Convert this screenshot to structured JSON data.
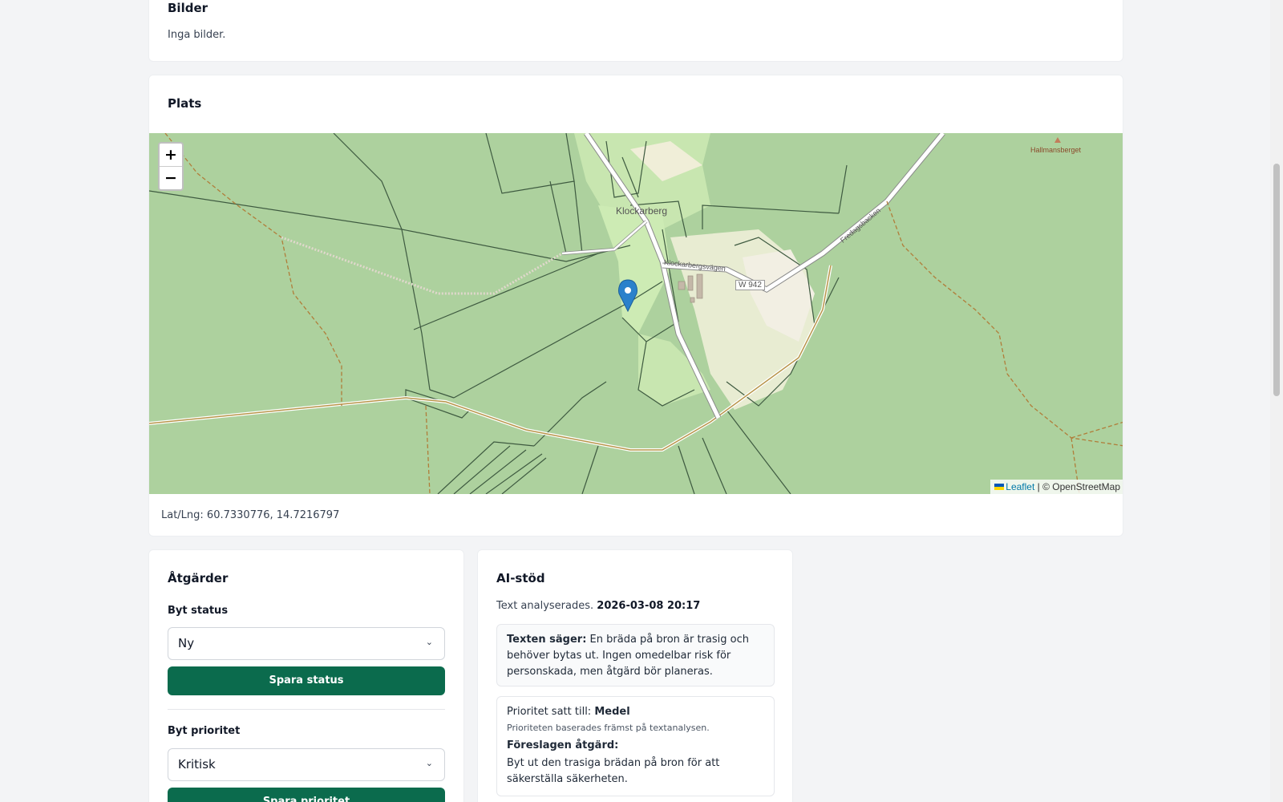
{
  "bilder": {
    "title": "Bilder",
    "empty_text": "Inga bilder."
  },
  "plats": {
    "title": "Plats",
    "map": {
      "zoom_in": "+",
      "zoom_out": "−",
      "labels": {
        "place": "Klockarberg",
        "road": "Klockarbergsvägen",
        "road_ref": "W 942",
        "road2": "Fredagsbacken",
        "peak": "Hallmansberget"
      },
      "attribution_leaflet": "Leaflet",
      "attribution_rest": " | © OpenStreetMap",
      "marker_icon": "map-marker-icon"
    },
    "latlng": "Lat/Lng: 60.7330776, 14.7216797"
  },
  "atgarder": {
    "title": "Åtgärder",
    "status_label": "Byt status",
    "status_value": "Ny",
    "status_button": "Spara status",
    "priority_label": "Byt prioritet",
    "priority_value": "Kritisk",
    "priority_button": "Spara prioritet"
  },
  "ai": {
    "title": "AI-stöd",
    "analyzed_prefix": "Text analyserades.",
    "analyzed_time": "2026-03-08 20:17",
    "says_label": "Texten säger:",
    "says_text": "En bräda på bron är trasig och behöver bytas ut. Ingen omedelbar risk för personskada, men åtgärd bör planeras.",
    "priority_prefix": "Prioritet satt till:",
    "priority_value": "Medel",
    "priority_note": "Prioriteten baserades främst på textanalysen.",
    "action_label": "Föreslagen åtgärd:",
    "action_text": "Byt ut den trasiga brädan på bron för att säkerställa säkerheten."
  },
  "colors": {
    "accent": "#0b6b4d",
    "map_forest": "#add19e",
    "marker": "#2a81cb"
  }
}
